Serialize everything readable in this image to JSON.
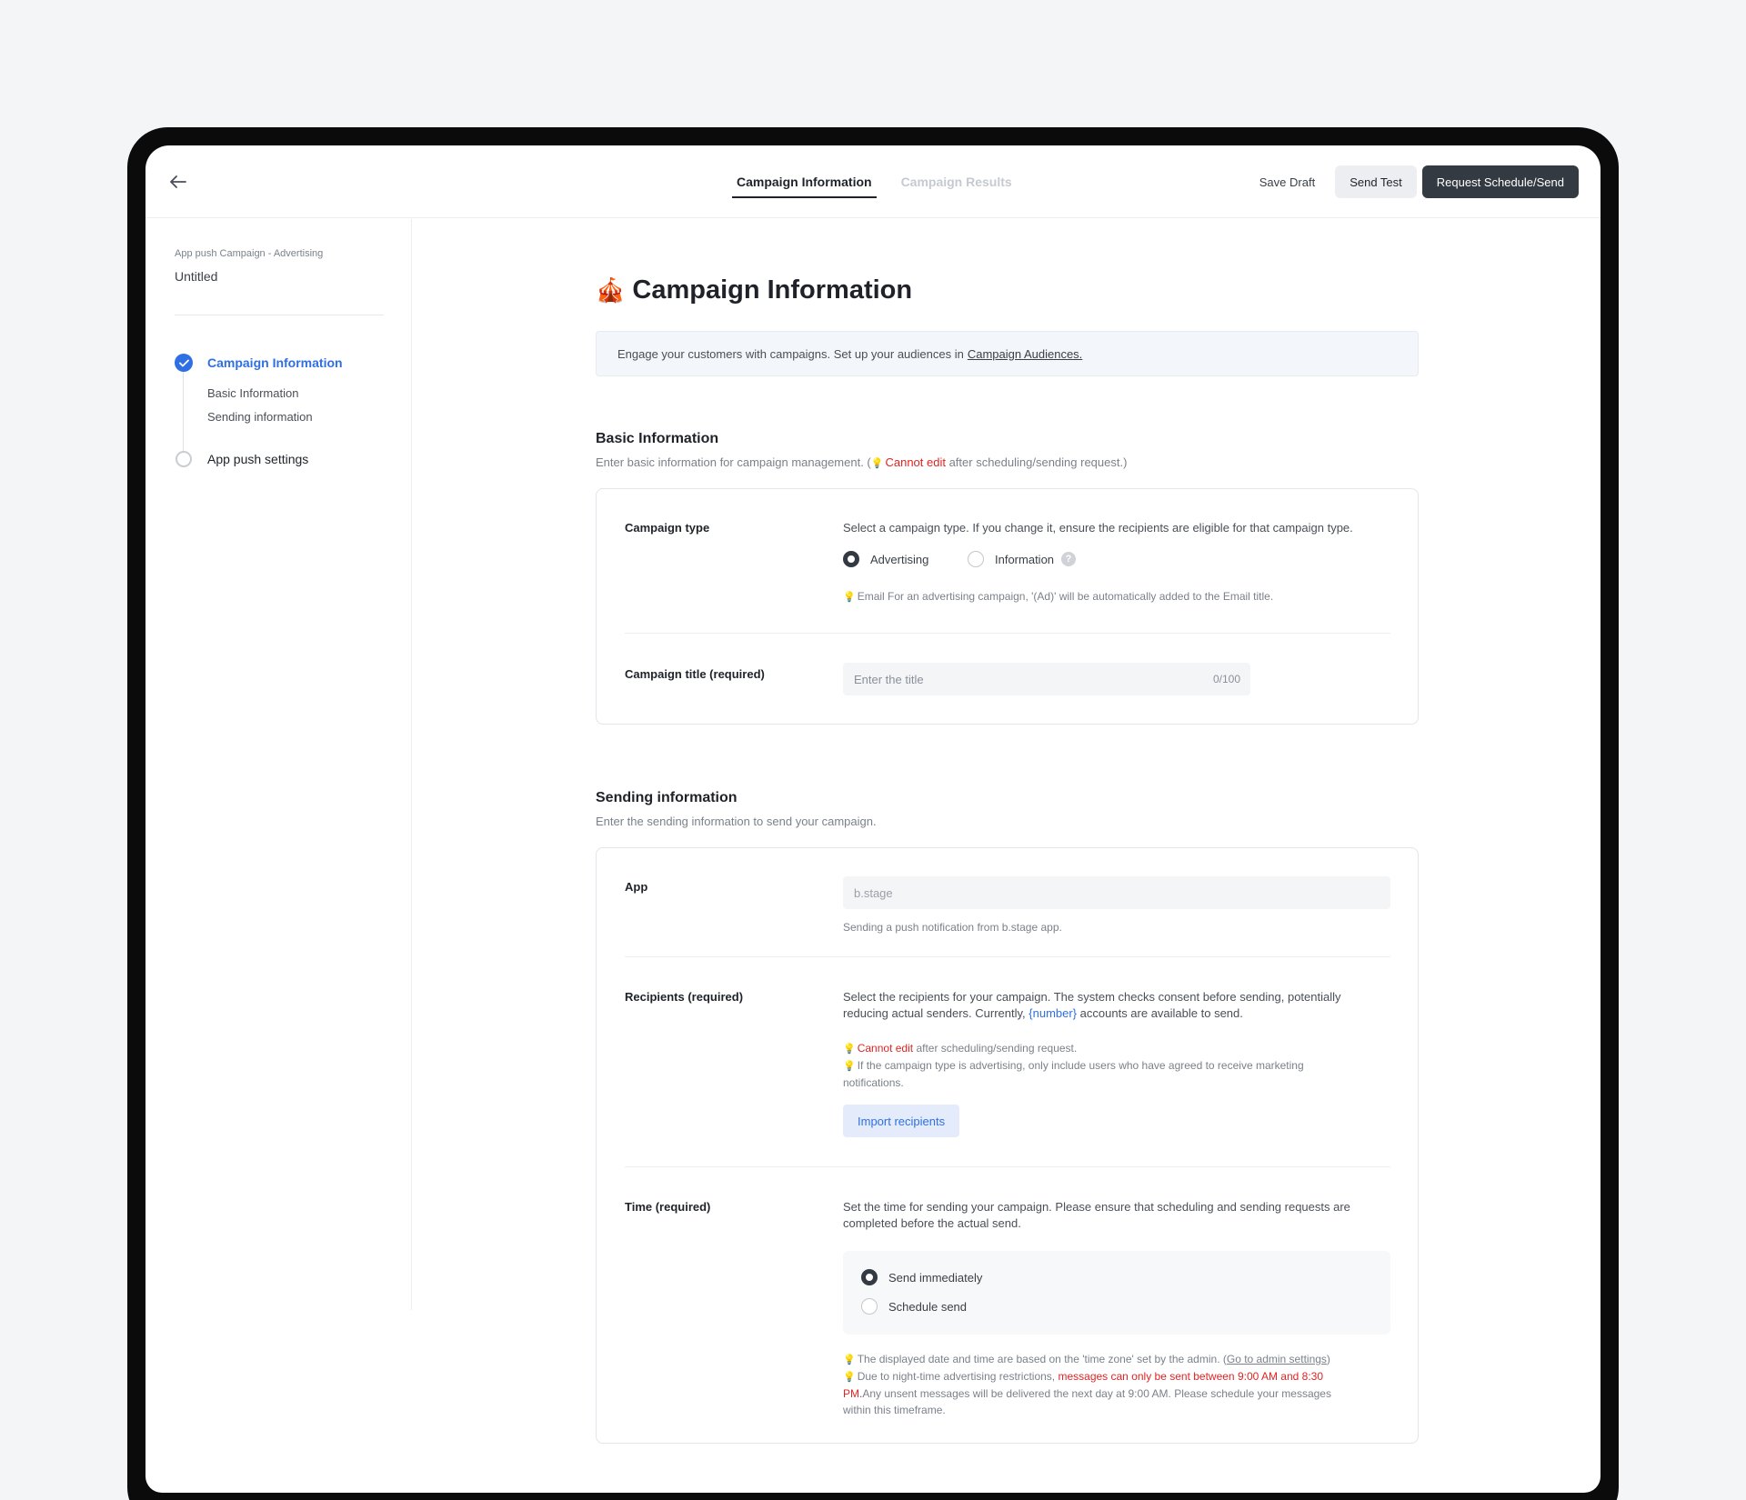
{
  "header": {
    "tabs": [
      {
        "label": "Campaign Information",
        "active": true
      },
      {
        "label": "Campaign Results",
        "active": false
      }
    ],
    "save_draft": "Save Draft",
    "send_test": "Send Test",
    "request": "Request Schedule/Send"
  },
  "sidebar": {
    "campaign_kind": "App push Campaign - Advertising",
    "campaign_name": "Untitled",
    "steps": [
      {
        "label": "Campaign Information",
        "status": "completed",
        "substeps": [
          "Basic Information",
          "Sending information"
        ]
      },
      {
        "label": "App push settings",
        "status": "pending"
      }
    ]
  },
  "main": {
    "title_emoji": "🎪",
    "title": "Campaign Information",
    "banner_text": "Engage your customers with campaigns. Set up your audiences in",
    "banner_link": "Campaign Audiences."
  },
  "basic": {
    "title": "Basic Information",
    "desc_before": "Enter basic information for campaign management. (",
    "desc_red": "Cannot edit",
    "desc_after": " after scheduling/sending request.)",
    "type_label": "Campaign type",
    "type_desc": "Select a campaign type. If you change it, ensure the recipients are eligible for that campaign type.",
    "type_options": [
      "Advertising",
      "Information"
    ],
    "type_selected": "Advertising",
    "type_hint": "Email For an advertising campaign, '(Ad)' will be automatically added to the Email title.",
    "title_label": "Campaign title (required)",
    "title_placeholder": "Enter the title",
    "title_counter": "0/100"
  },
  "sending": {
    "title": "Sending information",
    "desc": "Enter the sending information to send your campaign.",
    "app_label": "App",
    "app_value": "b.stage",
    "app_hint": "Sending a push notification from b.stage app.",
    "recipients_label": "Recipients (required)",
    "recipients_desc_1": "Select the recipients for your campaign. The system checks consent before sending, potentially",
    "recipients_desc_2": "reducing actual senders. Currently,",
    "recipients_number": "{number}",
    "recipients_desc_3": "accounts are available to send.",
    "recipients_hint1_red": "Cannot edit",
    "recipients_hint1_rest": "after scheduling/sending request.",
    "recipients_hint2_line1": "If the campaign type is advertising, only include users who have agreed to receive marketing",
    "recipients_hint2_line2": "notifications.",
    "import_button": "Import recipients",
    "time_label": "Time (required)",
    "time_desc_1": "Set the time for sending your campaign. Please ensure that scheduling and sending requests are",
    "time_desc_2": "completed before the actual send.",
    "time_options": [
      "Send immediately",
      "Schedule send"
    ],
    "time_selected": "Send immediately",
    "time_hint1_before": "The displayed date and time are based on the 'time zone' set by the admin. (",
    "time_hint1_link": "Go to admin settings",
    "time_hint1_after": ")",
    "time_hint2_before": "Due to night-time advertising restrictions,",
    "time_hint2_red_1": "messages can only be sent between 9:00 AM and 8:30",
    "time_hint2_red_2": "PM.",
    "time_hint2_after": "Any unsent messages will be delivered the next day at 9:00 AM. Please schedule your messages",
    "time_hint2_after_2": "within this timeframe."
  },
  "colors": {
    "accent": "#2f6fe4",
    "danger": "#e02424",
    "dark_button": "#343a42"
  }
}
